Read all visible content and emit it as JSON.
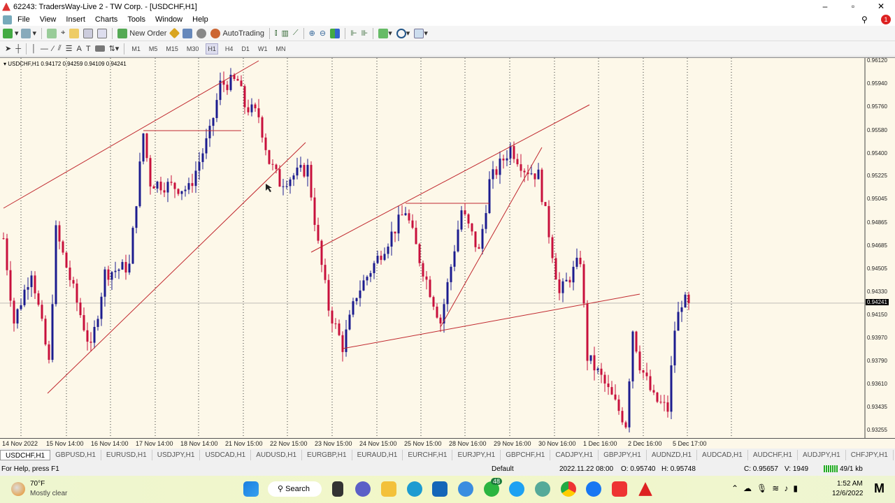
{
  "window": {
    "title": "62243: TradersWay-Live 2 - TW Corp. - [USDCHF,H1]",
    "minimize": "–",
    "maximize": "▫",
    "close": "✕"
  },
  "menu": [
    "File",
    "View",
    "Insert",
    "Charts",
    "Tools",
    "Window",
    "Help"
  ],
  "toolbar": {
    "new_order": "New Order",
    "autotrading": "AutoTrading",
    "timeframes": [
      "M1",
      "M5",
      "M15",
      "M30",
      "H1",
      "H4",
      "D1",
      "W1",
      "MN"
    ],
    "selected_timeframe": "H1",
    "alert_badge": "1"
  },
  "chart": {
    "info": "USDCHF,H1  0.94172 0.94259 0.94109 0.94241",
    "current_price": "0.94241",
    "price_ticks": [
      "0.96120",
      "0.95940",
      "0.95760",
      "0.95580",
      "0.95400",
      "0.95225",
      "0.95045",
      "0.94865",
      "0.94685",
      "0.94505",
      "0.94330",
      "0.94150",
      "0.93970",
      "0.93790",
      "0.93610",
      "0.93435",
      "0.93255"
    ],
    "date_ticks": [
      "14 Nov 2022",
      "15 Nov 14:00",
      "16 Nov 14:00",
      "17 Nov 14:00",
      "18 Nov 14:00",
      "21 Nov 15:00",
      "22 Nov 15:00",
      "23 Nov 15:00",
      "24 Nov 15:00",
      "25 Nov 15:00",
      "28 Nov 16:00",
      "29 Nov 16:00",
      "30 Nov 16:00",
      "1 Dec 16:00",
      "2 Dec 16:00",
      "5 Dec 17:00"
    ],
    "colors": {
      "background": "#fdf8e9",
      "bull": "#1c1c8f",
      "bear": "#c8103c",
      "trendline": "#c0282e"
    }
  },
  "chart_data": {
    "type": "candlestick",
    "ylim": [
      0.93255,
      0.9612
    ],
    "price_path": [
      [
        0,
        0.94744
      ],
      [
        3,
        0.94094
      ],
      [
        8,
        0.94501
      ],
      [
        13,
        0.93769
      ],
      [
        15,
        0.94799
      ],
      [
        25,
        0.93878
      ],
      [
        29,
        0.94474
      ],
      [
        36,
        0.94528
      ],
      [
        40,
        0.95557
      ],
      [
        42,
        0.95178
      ],
      [
        53,
        0.95123
      ],
      [
        59,
        0.95557
      ],
      [
        62,
        0.95936
      ],
      [
        67,
        0.95963
      ],
      [
        69,
        0.95773
      ],
      [
        73,
        0.95692
      ],
      [
        76,
        0.9534
      ],
      [
        79,
        0.95178
      ],
      [
        87,
        0.95286
      ],
      [
        90,
        0.9469
      ],
      [
        93,
        0.94203
      ],
      [
        97,
        0.93905
      ],
      [
        101,
        0.94311
      ],
      [
        115,
        0.94961
      ],
      [
        119,
        0.94582
      ],
      [
        125,
        0.94094
      ],
      [
        131,
        0.94961
      ],
      [
        136,
        0.94636
      ],
      [
        139,
        0.95178
      ],
      [
        145,
        0.95448
      ],
      [
        149,
        0.95286
      ],
      [
        153,
        0.95232
      ],
      [
        157,
        0.94636
      ],
      [
        159,
        0.94311
      ],
      [
        165,
        0.94582
      ],
      [
        167,
        0.93824
      ],
      [
        171,
        0.93661
      ],
      [
        178,
        0.93309
      ],
      [
        180,
        0.9404
      ],
      [
        182,
        0.93769
      ],
      [
        186,
        0.93499
      ],
      [
        190,
        0.93417
      ],
      [
        192,
        0.9404
      ],
      [
        194,
        0.94257
      ],
      [
        196,
        0.94241
      ]
    ]
  },
  "tabs": [
    "USDCHF,H1",
    "GBPUSD,H1",
    "EURUSD,H1",
    "USDJPY,H1",
    "USDCAD,H1",
    "AUDUSD,H1",
    "EURGBP,H1",
    "EURAUD,H1",
    "EURCHF,H1",
    "EURJPY,H1",
    "GBPCHF,H1",
    "CADJPY,H1",
    "GBPJPY,H1",
    "AUDNZD,H1",
    "AUDCAD,H1",
    "AUDCHF,H1",
    "AUDJPY,H1",
    "CHFJPY,H1"
  ],
  "status": {
    "help": "For Help, press F1",
    "profile": "Default",
    "datetime": "2022.11.22 08:00",
    "open": "O: 0.95740",
    "high": "H: 0.95748",
    "close": "C: 0.95657",
    "volume": "V: 1949",
    "traffic": "49/1 kb"
  },
  "taskbar": {
    "temp": "70°F",
    "weather": "Mostly clear",
    "search": "Search",
    "badge": "48",
    "time": "1:52 AM",
    "date": "12/6/2022"
  }
}
